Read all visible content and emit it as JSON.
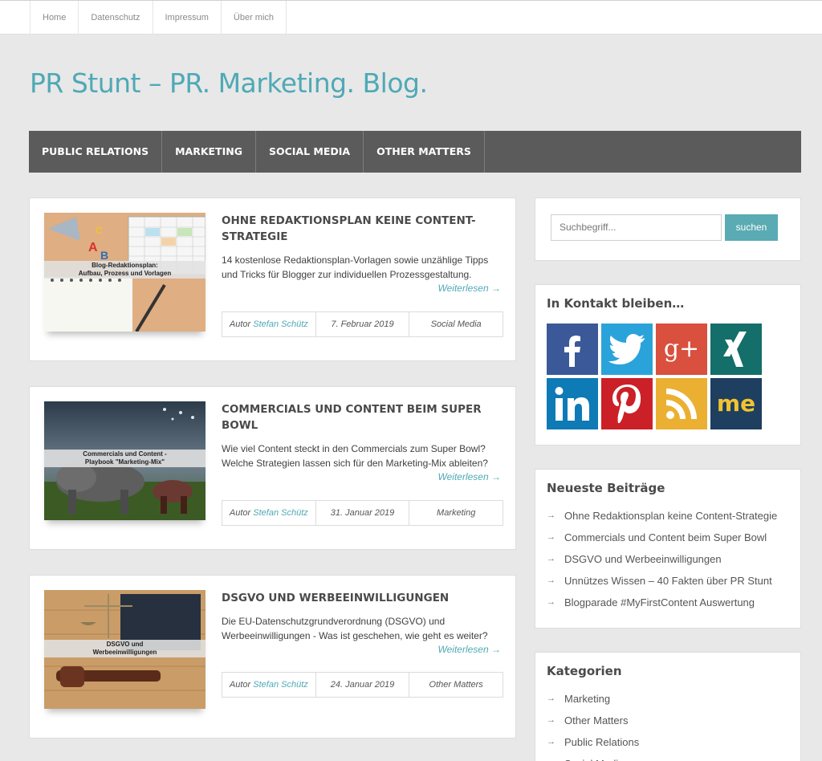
{
  "topnav": [
    "Home",
    "Datenschutz",
    "Impressum",
    "Über mich"
  ],
  "site_title": "PR Stunt – PR. Marketing. Blog.",
  "mainnav": [
    "PUBLIC RELATIONS",
    "MARKETING",
    "SOCIAL MEDIA",
    "OTHER MATTERS"
  ],
  "posts": [
    {
      "title": "OHNE REDAKTIONSPLAN KEINE CONTENT-STRATEGIE",
      "thumb_text_1": "Blog-Redaktionsplan:",
      "thumb_text_2": "Aufbau, Prozess und Vorlagen",
      "excerpt": "14 kostenlose Redaktionsplan-Vorlagen sowie unzählige Tipps und Tricks für Blogger zur individuellen Prozessgestaltung.",
      "readmore": "Weiterlesen →",
      "author_prefix": "Autor",
      "author": "Stefan Schütz",
      "date": "7. Februar 2019",
      "category": "Social Media"
    },
    {
      "title": "COMMERCIALS UND CONTENT BEIM SUPER BOWL",
      "thumb_text_1": "Commercials und Content -",
      "thumb_text_2": "Playbook \"Marketing-Mix\"",
      "excerpt": "Wie viel Content steckt in den Commercials zum Super Bowl? Welche Strategien lassen sich für den Marketing-Mix ableiten?",
      "readmore": "Weiterlesen →",
      "author_prefix": "Autor",
      "author": "Stefan Schütz",
      "date": "31. Januar 2019",
      "category": "Marketing"
    },
    {
      "title": "DSGVO UND WERBEEINWILLIGUNGEN",
      "thumb_text_1": "DSGVO und",
      "thumb_text_2": "Werbeeinwilligungen",
      "excerpt": "Die EU-Datenschutzgrundverordnung (DSGVO) und Werbeeinwilligungen - Was ist geschehen, wie geht es weiter?",
      "readmore": "Weiterlesen →",
      "author_prefix": "Autor",
      "author": "Stefan Schütz",
      "date": "24. Januar 2019",
      "category": "Other Matters"
    }
  ],
  "search": {
    "placeholder": "Suchbegriff...",
    "button": "suchen"
  },
  "contact": {
    "title": "In Kontakt bleiben…",
    "networks": [
      "facebook",
      "twitter",
      "google-plus",
      "xing",
      "linkedin",
      "pinterest",
      "rss",
      "aboutme"
    ],
    "colors": [
      "#3b5998",
      "#2aa3db",
      "#d9503f",
      "#146e69",
      "#0e7ab6",
      "#cb2027",
      "#ebb031",
      "#1e3f5f"
    ],
    "glyphs": {
      "googleplus": "g+",
      "aboutme": "me"
    }
  },
  "recent": {
    "title": "Neueste Beiträge",
    "items": [
      "Ohne Redaktionsplan keine Content-Strategie",
      "Commercials und Content beim Super Bowl",
      "DSGVO und Werbeeinwilligungen",
      "Unnützes Wissen – 40 Fakten über PR Stunt",
      "Blogparade #MyFirstContent Auswertung"
    ]
  },
  "categories": {
    "title": "Kategorien",
    "items": [
      "Marketing",
      "Other Matters",
      "Public Relations",
      "Social Media"
    ]
  }
}
